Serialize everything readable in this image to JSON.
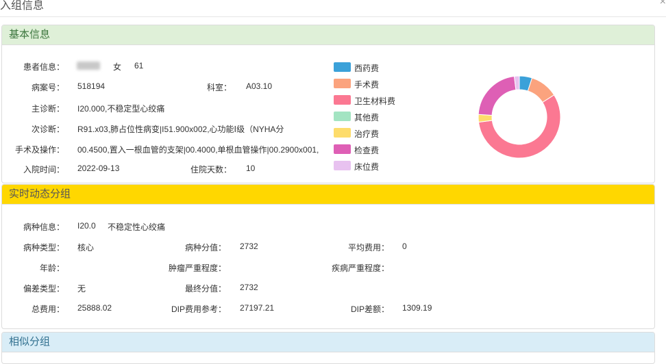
{
  "window": {
    "title": "入组信息",
    "close": "×"
  },
  "basic": {
    "header": "基本信息",
    "patient_label": "患者信息：",
    "gender": "女",
    "age": "61",
    "case_no_label": "病案号：",
    "case_no": "518194",
    "dept_label": "科室：",
    "dept": "A03.10",
    "main_diag_label": "主诊断：",
    "main_diag": "I20.000,不稳定型心绞痛",
    "sec_diag_label": "次诊断：",
    "sec_diag": "R91.x03,肺占位性病变|I51.900x002,心功能Ⅰ级（NYHA分",
    "surgery_label": "手术及操作：",
    "surgery": "00.4500,置入一根血管的支架|00.4000,单根血管操作|00.2900x001,",
    "admit_label": "入院时间：",
    "admit_date": "2022-09-13",
    "stay_label": "住院天数：",
    "stay_days": "10"
  },
  "legend": [
    {
      "label": "西药费",
      "color": "#3ba1d9"
    },
    {
      "label": "手术费",
      "color": "#fba37e"
    },
    {
      "label": "卫生材料费",
      "color": "#fb7892"
    },
    {
      "label": "其他费",
      "color": "#a3e4c2"
    },
    {
      "label": "治疗费",
      "color": "#fddc6b"
    },
    {
      "label": "检查费",
      "color": "#de5fb5"
    },
    {
      "label": "床位费",
      "color": "#e8c2f0"
    }
  ],
  "chart_data": {
    "type": "pie",
    "categories": [
      "西药费",
      "手术费",
      "卫生材料费",
      "其他费",
      "治疗费",
      "检查费",
      "床位费"
    ],
    "values": [
      5,
      11,
      57,
      0,
      3,
      22,
      2
    ]
  },
  "realtime": {
    "header": "实时动态分组",
    "disease_label": "病种信息：",
    "disease_code": "I20.0",
    "disease_name": "不稳定性心绞痛",
    "type_label": "病种类型：",
    "type_value": "核心",
    "score_label": "病种分值：",
    "score_value": "2732",
    "avg_cost_label": "平均费用：",
    "avg_cost": "0",
    "age_label": "年龄：",
    "age_value": "",
    "tumor_label": "肿瘤严重程度：",
    "tumor_value": "",
    "disease_sev_label": "疾病严重程度：",
    "disease_sev_value": "",
    "deviation_label": "偏差类型：",
    "deviation_value": "无",
    "final_score_label": "最终分值：",
    "final_score": "2732",
    "total_label": "总费用：",
    "total_value": "25888.02",
    "dip_ref_label": "DIP费用参考：",
    "dip_ref": "27197.21",
    "dip_diff_label": "DIP差额：",
    "dip_diff": "1309.19"
  },
  "similar": {
    "header": "相似分组"
  }
}
